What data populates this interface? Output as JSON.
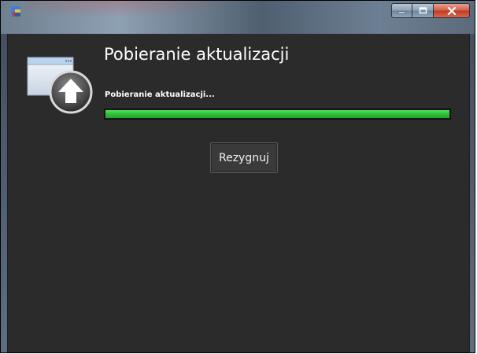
{
  "window": {
    "title": "",
    "controls": {
      "minimize": "minimize-icon",
      "maximize": "maximize-icon",
      "close": "close-icon"
    }
  },
  "main": {
    "heading": "Pobieranie aktualizacji",
    "status": "Pobieranie aktualizacji...",
    "progress": 1.0,
    "progress_color": "#2fbf3a",
    "cancel_label": "Rezygnuj",
    "icon": "update-download-icon"
  }
}
